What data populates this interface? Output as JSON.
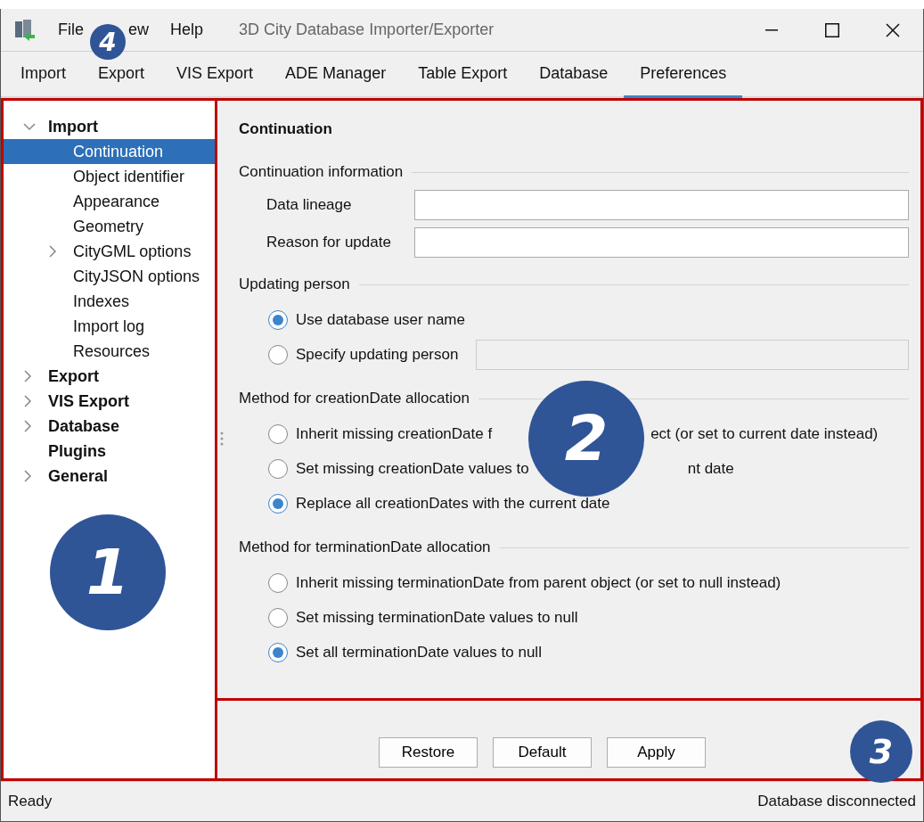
{
  "window": {
    "title": "3D City Database Importer/Exporter",
    "menu": [
      "File",
      "ew",
      "Help"
    ]
  },
  "tabs": [
    {
      "label": "Import",
      "selected": false
    },
    {
      "label": "Export",
      "selected": false
    },
    {
      "label": "VIS Export",
      "selected": false
    },
    {
      "label": "ADE Manager",
      "selected": false
    },
    {
      "label": "Table Export",
      "selected": false
    },
    {
      "label": "Database",
      "selected": false
    },
    {
      "label": "Preferences",
      "selected": true
    }
  ],
  "sidebar": {
    "items": [
      {
        "label": "Import",
        "kind": "branch",
        "expanded": true,
        "selected": false,
        "children": [
          {
            "label": "Continuation",
            "selected": true
          },
          {
            "label": "Object identifier",
            "selected": false
          },
          {
            "label": "Appearance",
            "selected": false
          },
          {
            "label": "Geometry",
            "selected": false
          },
          {
            "label": "CityGML options",
            "kind": "branch",
            "expanded": false,
            "selected": false
          },
          {
            "label": "CityJSON options",
            "selected": false
          },
          {
            "label": "Indexes",
            "selected": false
          },
          {
            "label": "Import log",
            "selected": false
          },
          {
            "label": "Resources",
            "selected": false
          }
        ]
      },
      {
        "label": "Export",
        "kind": "branch",
        "expanded": false,
        "selected": false
      },
      {
        "label": "VIS Export",
        "kind": "branch",
        "expanded": false,
        "selected": false
      },
      {
        "label": "Database",
        "kind": "branch",
        "expanded": false,
        "selected": false
      },
      {
        "label": "Plugins",
        "kind": "leaf",
        "selected": false
      },
      {
        "label": "General",
        "kind": "branch",
        "expanded": false,
        "selected": false
      }
    ]
  },
  "panel": {
    "title": "Continuation",
    "groups": [
      {
        "title": "Continuation information",
        "kind": "fields",
        "fields": [
          {
            "label": "Data lineage"
          },
          {
            "label": "Reason for update"
          }
        ]
      },
      {
        "title": "Updating person",
        "kind": "radios",
        "options": [
          {
            "label": "Use database user name",
            "selected": true
          },
          {
            "label": "Specify updating person",
            "selected": false,
            "field": {
              "disabled": true
            }
          }
        ]
      },
      {
        "title": "Method for creationDate allocation",
        "kind": "radios",
        "options": [
          {
            "label": "Inherit missing creationDate f",
            "label_after": "ect (or set to current date instead)",
            "selected": false
          },
          {
            "label": "Set missing creationDate values to",
            "label_after": "nt date",
            "selected": false
          },
          {
            "label": "Replace all creationDates with the current date",
            "selected": true
          }
        ]
      },
      {
        "title": "Method for terminationDate allocation",
        "kind": "radios",
        "options": [
          {
            "label": "Inherit missing terminationDate from parent object (or set to null instead)",
            "selected": false
          },
          {
            "label": "Set missing terminationDate values to null",
            "selected": false
          },
          {
            "label": "Set all terminationDate values to null",
            "selected": true
          }
        ]
      }
    ]
  },
  "buttons": [
    "Restore",
    "Default",
    "Apply"
  ],
  "status_bar": {
    "left": "Ready",
    "right": "Database disconnected"
  },
  "annotations": [
    {
      "label": "4"
    },
    {
      "label": "1"
    },
    {
      "label": "2"
    },
    {
      "label": "3"
    }
  ]
}
